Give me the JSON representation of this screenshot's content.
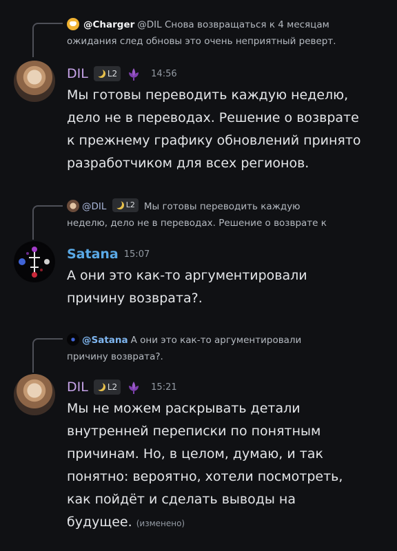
{
  "messages": [
    {
      "reply": {
        "author": "@Charger",
        "text": "@DIL Снова возвращаться к 4 месяцам ожидания след обновы это очень неприятный реверт.",
        "line1": "@DIL Снова возвращаться к 4 месяцам",
        "line2": "ожидания след обновы это очень неприятный реверт."
      },
      "author": "DIL",
      "badge": "L2",
      "time": "14:56",
      "lines": [
        "Мы готовы переводить каждую неделю,",
        "дело не в переводах. Решение о возврате",
        "к прежнему графику обновлений принято",
        "разработчиком для всех регионов."
      ]
    },
    {
      "reply": {
        "author": "@DIL",
        "badge": "L2",
        "line1": "Мы готовы переводить каждую",
        "line2": "неделю, дело не в переводах. Решение о возврате к"
      },
      "author": "Satana",
      "time": "15:07",
      "lines": [
        "А они это как-то аргументировали",
        "причину возврата?."
      ]
    },
    {
      "reply": {
        "author": "@Satana",
        "line1": "А они это как-то аргументировали",
        "line2": "причину возврата?."
      },
      "author": "DIL",
      "badge": "L2",
      "time": "15:21",
      "lines": [
        "Мы не можем раскрывать детали",
        "внутренней переписки по понятным",
        "причинам. Но, в целом, думаю, и так",
        "понятно: вероятно, хотели посмотреть,",
        "как пойдёт и сделать выводы на",
        "будущее."
      ],
      "edited": "(изменено)"
    }
  ]
}
